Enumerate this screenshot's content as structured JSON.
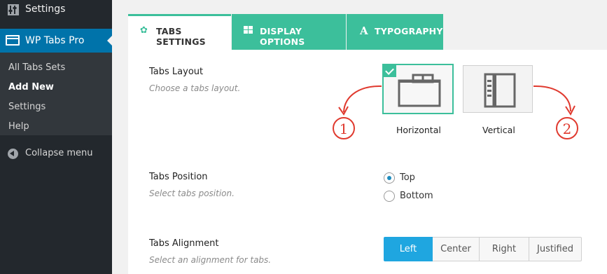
{
  "sidebar": {
    "settings_top": "Settings",
    "current": "WP Tabs Pro",
    "submenu": [
      "All Tabs Sets",
      "Add New",
      "Settings",
      "Help"
    ],
    "collapse": "Collapse menu"
  },
  "tabs": [
    {
      "label": "TABS SETTINGS",
      "icon": "gear-icon"
    },
    {
      "label": "DISPLAY OPTIONS",
      "icon": "grid-icon"
    },
    {
      "label": "TYPOGRAPHY",
      "icon": "font-icon"
    }
  ],
  "layout": {
    "title": "Tabs Layout",
    "desc": "Choose a tabs layout.",
    "options": [
      "Horizontal",
      "Vertical"
    ],
    "selected": "Horizontal",
    "annotations": [
      "1",
      "2"
    ]
  },
  "position": {
    "title": "Tabs Position",
    "desc": "Select tabs position.",
    "options": [
      "Top",
      "Bottom"
    ],
    "selected": "Top"
  },
  "alignment": {
    "title": "Tabs Alignment",
    "desc": "Select an alignment for tabs.",
    "options": [
      "Left",
      "Center",
      "Right",
      "Justified"
    ],
    "selected": "Left"
  },
  "colors": {
    "sidebar": "#23282d",
    "submenu": "#32373c",
    "wp_blue": "#0073aa",
    "accent_green": "#3cbf9b",
    "button_blue": "#1fa6e0",
    "annotation_red": "#e03a2f"
  }
}
